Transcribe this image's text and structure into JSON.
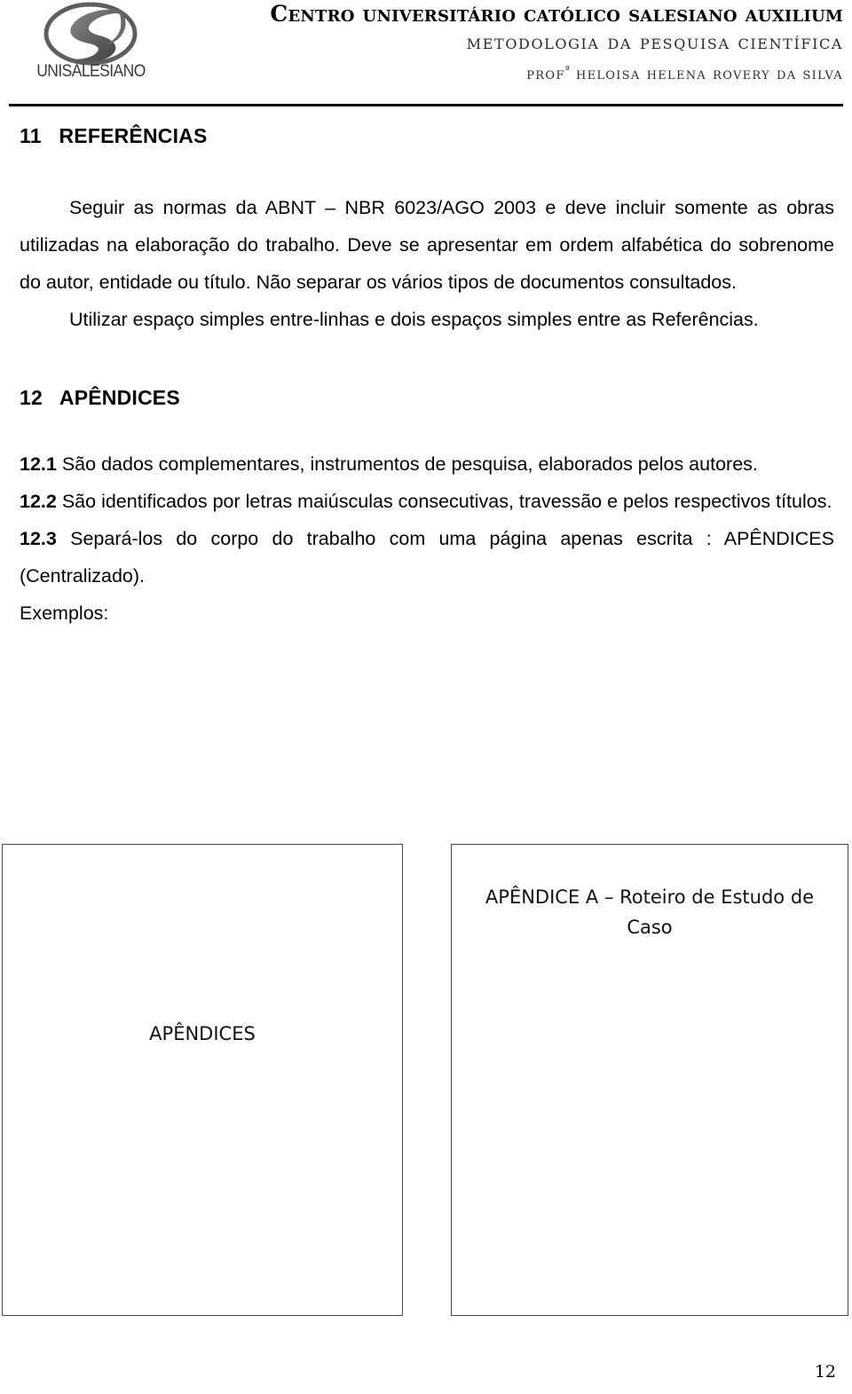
{
  "document": {
    "page_number": "12"
  },
  "header": {
    "logo": {
      "icon": "unisalesiano-s-logo",
      "wordmark": "UNISALESIANO"
    },
    "institution": "Centro Universitário Católico Salesiano Auxilium",
    "course": "Metodologia da Pesquisa Científica",
    "professor_prefix": "Prof",
    "professor_suffix": "ª",
    "professor_name": "Heloisa Helena Rovery da Silva"
  },
  "sections": [
    {
      "number": "11",
      "title": "REFERÊNCIAS",
      "heading_text": "11   REFERÊNCIAS",
      "paragraphs": [
        "Seguir as normas da ABNT – NBR 6023/AGO 2003 e deve incluir somente as obras utilizadas na elaboração do trabalho.  Deve se apresentar em ordem alfabética do sobrenome do autor, entidade ou título. Não separar os vários tipos de documentos consultados.",
        "Utilizar espaço simples entre-linhas e dois espaços simples entre as Referências."
      ]
    },
    {
      "number": "12",
      "title": "APÊNDICES",
      "heading_text": "12   APÊNDICES",
      "items": [
        {
          "label": "12.1",
          "text": "São dados complementares, instrumentos de pesquisa, elaborados pelos autores."
        },
        {
          "label": "12.2",
          "text": "São identificados por letras maiúsculas consecutivas, travessão e pelos respectivos títulos."
        },
        {
          "label": "12.3",
          "text": "Separá-los do corpo do trabalho com uma página apenas escrita : APÊNDICES (Centralizado)."
        }
      ],
      "examples_label": "Exemplos:"
    }
  ],
  "example_boxes": [
    {
      "name": "apendices-cover-page",
      "text": "APÊNDICES"
    },
    {
      "name": "apendice-a-page",
      "text": "APÊNDICE A – Roteiro de Estudo de Caso"
    }
  ]
}
